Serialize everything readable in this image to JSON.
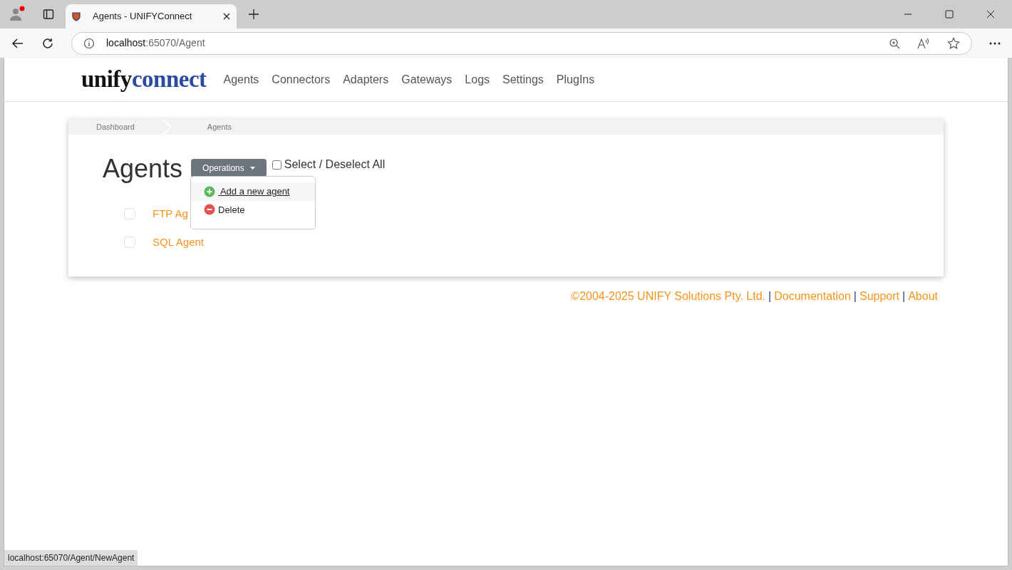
{
  "browser": {
    "tab_title": "Agents - UNIFYConnect",
    "address": {
      "host": "localhost",
      "path": ":65070/Agent"
    },
    "status_url": "localhost:65070/Agent/NewAgent"
  },
  "logo": {
    "part_1": "unify",
    "part_2": "connect"
  },
  "nav": [
    {
      "label": "Agents"
    },
    {
      "label": "Connectors"
    },
    {
      "label": "Adapters"
    },
    {
      "label": "Gateways"
    },
    {
      "label": "Logs"
    },
    {
      "label": "Settings"
    },
    {
      "label": "PlugIns"
    }
  ],
  "breadcrumb": [
    {
      "label": "Dashboard"
    },
    {
      "label": "Agents"
    }
  ],
  "heading": "Agents",
  "operations": {
    "label": "Operations",
    "expanded": true,
    "menu": [
      {
        "label": " Add a new agent",
        "kind": "add",
        "highlighted": true
      },
      {
        "label": "Delete",
        "kind": "delete",
        "highlighted": false
      }
    ]
  },
  "select_all": {
    "label": "Select / Deselect All",
    "checked": false
  },
  "agents": [
    {
      "name": "FTP Ag",
      "checked": false
    },
    {
      "name": "SQL Agent",
      "checked": false
    }
  ],
  "footer": {
    "items": [
      {
        "text": "©2004-2025 UNIFY Solutions Pty. Ltd.",
        "kind": "copyright"
      },
      {
        "text": "|",
        "kind": "separator"
      },
      {
        "text": "Documentation",
        "kind": "link"
      },
      {
        "text": "|",
        "kind": "separator"
      },
      {
        "text": "Support",
        "kind": "link"
      },
      {
        "text": "|",
        "kind": "separator"
      },
      {
        "text": "About",
        "kind": "link"
      }
    ]
  }
}
